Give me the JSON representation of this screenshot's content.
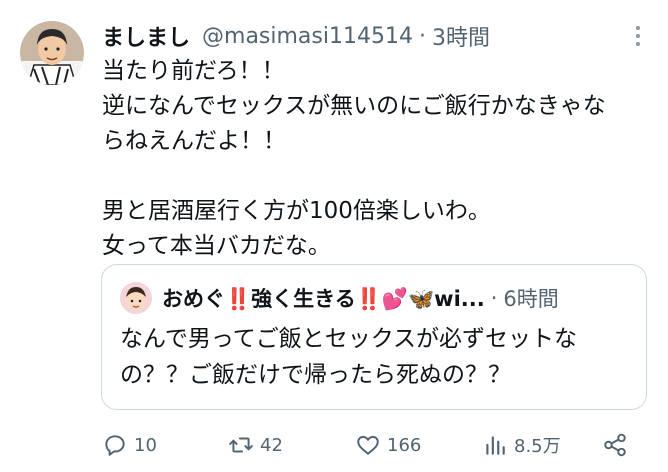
{
  "tweet": {
    "display_name": "ましまし",
    "handle": "@masimasi114514",
    "separator": "·",
    "time": "3時間",
    "text": "当たり前だろ！！\n逆になんでセックスが無いのにご飯行かなきゃな\nらねえんだよ！！\n\n男と居酒屋行く方が100倍楽しいわ。\n女って本当バカだな。"
  },
  "quoted": {
    "display_name": "おめぐ‼️強く生きる‼️💕🦋wi...",
    "separator": "·",
    "time": "6時間",
    "text": "なんで男ってご飯とセックスが必ずセットな\nの？？ご飯だけで帰ったら死ぬの？？"
  },
  "actions": {
    "replies": "10",
    "retweets": "42",
    "likes": "166",
    "views": "8.5万"
  },
  "icons": [
    "avatar",
    "more-icon",
    "reply-icon",
    "retweet-icon",
    "like-icon",
    "views-icon",
    "share-icon"
  ],
  "colors": {
    "text": "#0f1419",
    "secondary": "#536471",
    "border": "#cfd9de"
  }
}
